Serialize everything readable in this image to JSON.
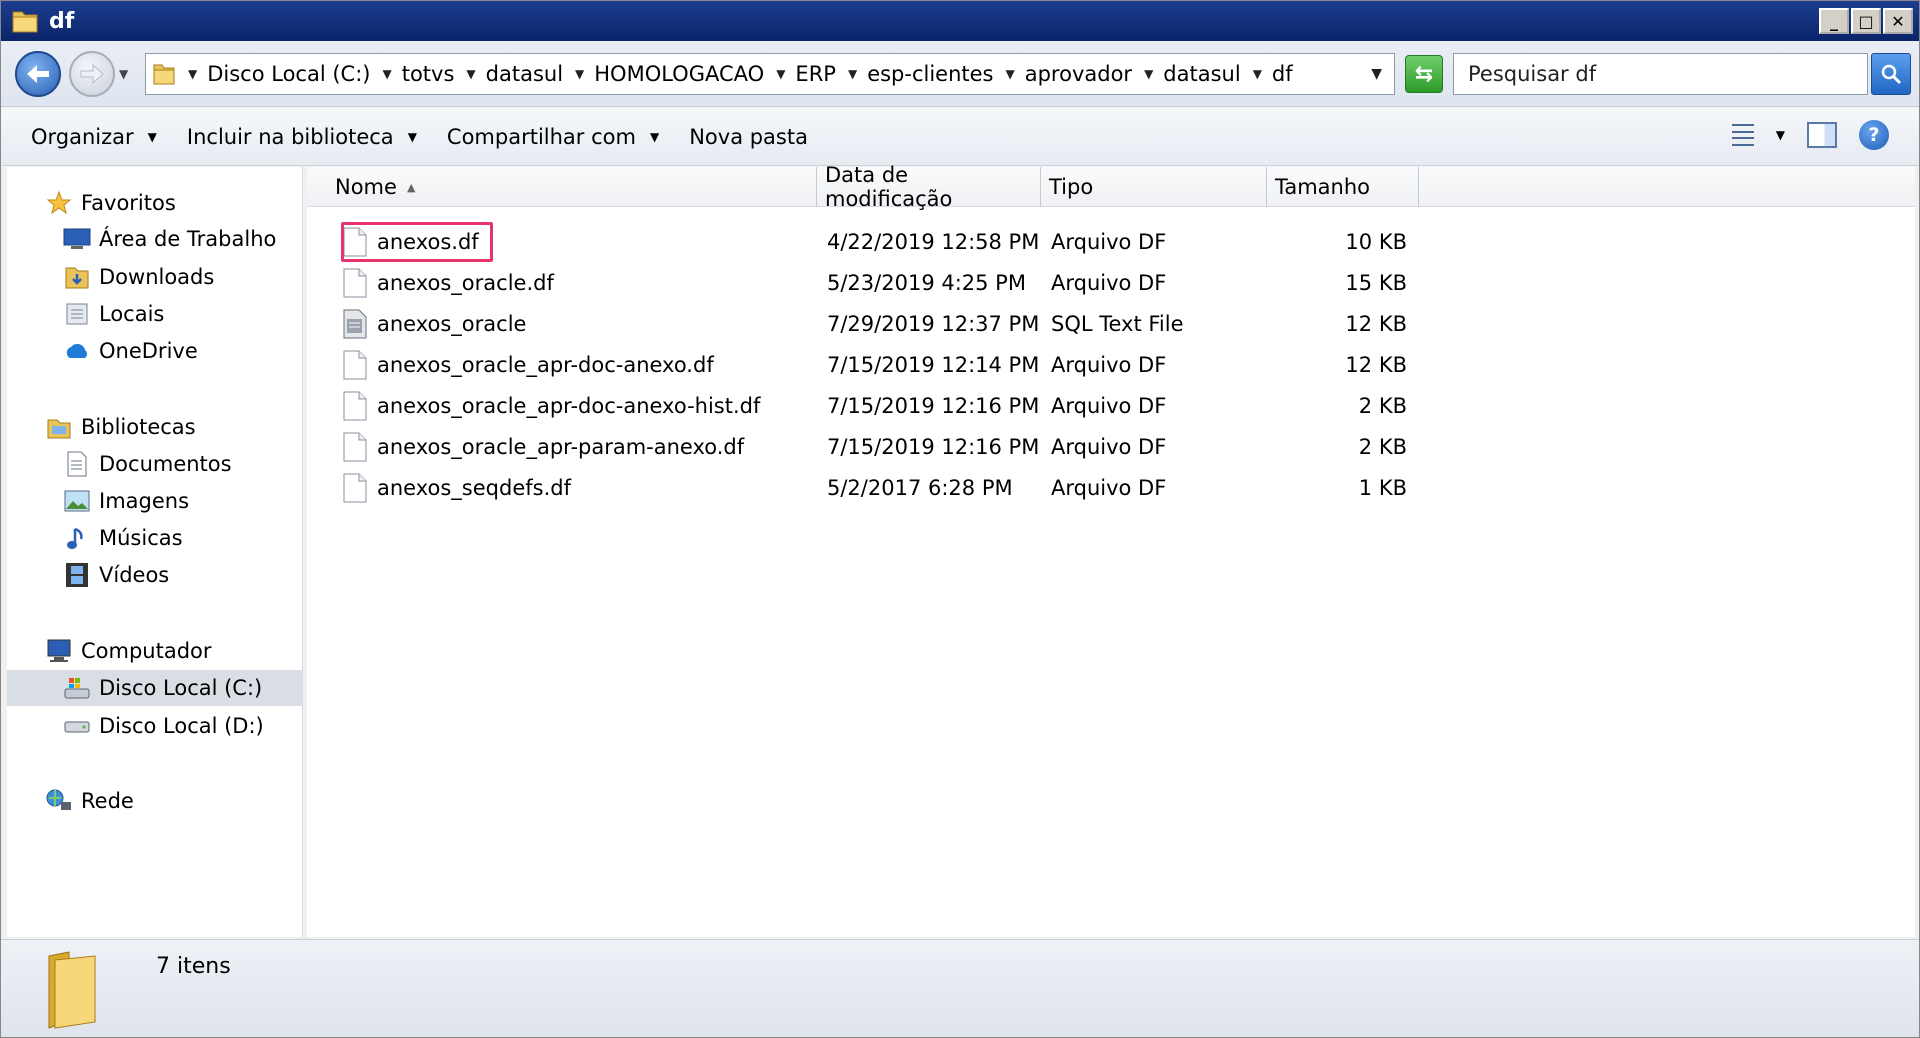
{
  "window": {
    "title": "df"
  },
  "address": {
    "crumbs": [
      "Disco Local (C:)",
      "totvs",
      "datasul",
      "HOMOLOGACAO",
      "ERP",
      "esp-clientes",
      "aprovador",
      "datasul",
      "df"
    ],
    "search_placeholder": "Pesquisar df"
  },
  "toolbar": {
    "organize": "Organizar",
    "include": "Incluir na biblioteca",
    "share": "Compartilhar com",
    "new_folder": "Nova pasta"
  },
  "nav": {
    "favorites": "Favoritos",
    "desktop": "Área de Trabalho",
    "downloads": "Downloads",
    "locais": "Locais",
    "onedrive": "OneDrive",
    "libraries": "Bibliotecas",
    "documents": "Documentos",
    "images": "Imagens",
    "music": "Músicas",
    "videos": "Vídeos",
    "computer": "Computador",
    "disk_c": "Disco Local (C:)",
    "disk_d": "Disco Local (D:)",
    "network": "Rede"
  },
  "columns": {
    "name": "Nome",
    "date": "Data de modificação",
    "type": "Tipo",
    "size": "Tamanho"
  },
  "files": [
    {
      "name": "anexos.df",
      "date": "4/22/2019 12:58 PM",
      "type": "Arquivo DF",
      "size": "10 KB",
      "icon": "document-icon"
    },
    {
      "name": "anexos_oracle.df",
      "date": "5/23/2019 4:25 PM",
      "type": "Arquivo DF",
      "size": "15 KB",
      "icon": "document-icon"
    },
    {
      "name": "anexos_oracle",
      "date": "7/29/2019 12:37 PM",
      "type": "SQL Text File",
      "size": "12 KB",
      "icon": "sql-file-icon"
    },
    {
      "name": "anexos_oracle_apr-doc-anexo.df",
      "date": "7/15/2019 12:14 PM",
      "type": "Arquivo DF",
      "size": "12 KB",
      "icon": "document-icon"
    },
    {
      "name": "anexos_oracle_apr-doc-anexo-hist.df",
      "date": "7/15/2019 12:16 PM",
      "type": "Arquivo DF",
      "size": "2 KB",
      "icon": "document-icon"
    },
    {
      "name": "anexos_oracle_apr-param-anexo.df",
      "date": "7/15/2019 12:16 PM",
      "type": "Arquivo DF",
      "size": "2 KB",
      "icon": "document-icon"
    },
    {
      "name": "anexos_seqdefs.df",
      "date": "5/2/2017 6:28 PM",
      "type": "Arquivo DF",
      "size": "1 KB",
      "icon": "document-icon"
    }
  ],
  "status": {
    "count": "7 itens"
  },
  "colors": {
    "highlight": "#e8336b",
    "titlebar": "#0a246a",
    "selection": "#d9dde4"
  }
}
